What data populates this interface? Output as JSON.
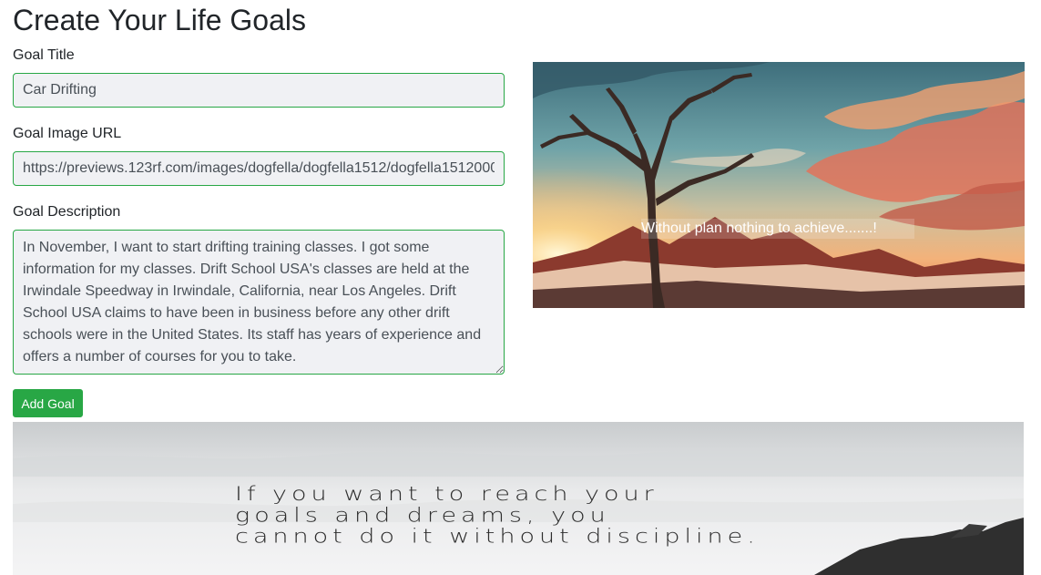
{
  "page_title": "Create Your Life Goals",
  "form": {
    "title_label": "Goal Title",
    "title_value": "Car Drifting",
    "image_label": "Goal Image URL",
    "image_value": "https://previews.123rf.com/images/dogfella/dogfella1512/dogfella151200035/49335153-dark-landscape.jpg",
    "description_label": "Goal Description",
    "description_value": "In November, I want to start drifting training classes. I got some information for my classes. Drift School USA's classes are held at the Irwindale Speedway in Irwindale, California, near Los Angeles. Drift School USA claims to have been in business before any other drift schools were in the United States. Its staff has years of experience and offers a number of courses for you to take.",
    "submit_label": "Add Goal"
  },
  "preview": {
    "caption": "Without plan nothing to achieve.......!"
  },
  "banner": {
    "quote_lines": [
      "If you want to reach your",
      "goals and dreams, you",
      "cannot do it without discipline."
    ]
  },
  "colors": {
    "accent": "#28a745",
    "field_bg": "#f0f1f4"
  },
  "icons": {
    "preview_art": "tree-sunset-landscape",
    "banner_art": "misty-mountains"
  }
}
